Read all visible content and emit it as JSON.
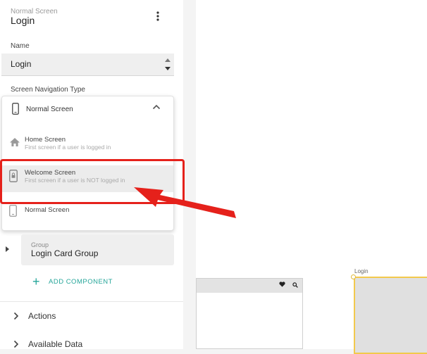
{
  "header": {
    "screen_type": "Normal Screen",
    "title": "Login"
  },
  "name_field": {
    "label": "Name",
    "value": "Login"
  },
  "nav_type": {
    "label": "Screen Navigation Type",
    "selected": "Normal Screen",
    "options": [
      {
        "title": "Home Screen",
        "subtitle": "First screen if a user is logged in",
        "icon": "home-icon"
      },
      {
        "title": "Welcome Screen",
        "subtitle": "First screen if a user is NOT logged in",
        "icon": "lock-phone-icon"
      },
      {
        "title": "Normal Screen",
        "subtitle": "",
        "icon": "phone-icon"
      }
    ]
  },
  "group": {
    "label": "Group",
    "name": "Login Card Group"
  },
  "add_component": {
    "label": "ADD COMPONENT"
  },
  "sections": [
    {
      "label": "Actions"
    },
    {
      "label": "Available Data"
    }
  ],
  "canvas": {
    "screen_label": "Login"
  },
  "colors": {
    "accent": "#26a69a",
    "annotation": "#e5211b",
    "selection": "#f2c94c"
  }
}
